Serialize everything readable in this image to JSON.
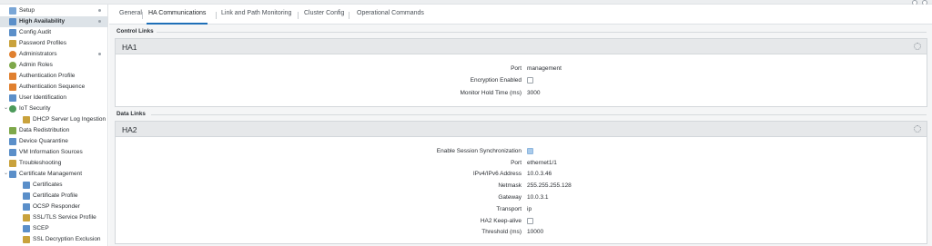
{
  "sidebar": {
    "items": [
      {
        "label": "Setup",
        "color": "#7aa6d6"
      },
      {
        "label": "High Availability",
        "color": "#5b8fc9"
      },
      {
        "label": "Config Audit",
        "color": "#5b8fc9"
      },
      {
        "label": "Password Profiles",
        "color": "#c9a23c"
      },
      {
        "label": "Administrators",
        "color": "#e0802f"
      },
      {
        "label": "Admin Roles",
        "color": "#7ea84a"
      },
      {
        "label": "Authentication Profile",
        "color": "#e0802f"
      },
      {
        "label": "Authentication Sequence",
        "color": "#e0802f"
      },
      {
        "label": "User Identification",
        "color": "#5b8fc9"
      },
      {
        "label": "IoT Security",
        "color": "#4c9a5a"
      },
      {
        "label": "DHCP Server Log Ingestion",
        "color": "#c9a23c"
      },
      {
        "label": "Data Redistribution",
        "color": "#7ea84a"
      },
      {
        "label": "Device Quarantine",
        "color": "#5b8fc9"
      },
      {
        "label": "VM Information Sources",
        "color": "#5b8fc9"
      },
      {
        "label": "Troubleshooting",
        "color": "#c9a23c"
      },
      {
        "label": "Certificate Management",
        "color": "#5b8fc9"
      },
      {
        "label": "Certificates",
        "color": "#5b8fc9"
      },
      {
        "label": "Certificate Profile",
        "color": "#5b8fc9"
      },
      {
        "label": "OCSP Responder",
        "color": "#5b8fc9"
      },
      {
        "label": "SSL/TLS Service Profile",
        "color": "#c9a23c"
      },
      {
        "label": "SCEP",
        "color": "#5b8fc9"
      },
      {
        "label": "SSL Decryption Exclusion",
        "color": "#c9a23c"
      }
    ]
  },
  "tabs": [
    "General",
    "HA Communications",
    "Link and Path Monitoring",
    "Cluster Config",
    "Operational Commands"
  ],
  "control_links": {
    "section_label": "Control Links",
    "panel_title": "HA1",
    "fields": {
      "port_label": "Port",
      "port_value": "management",
      "encryption_label": "Encryption Enabled",
      "encryption_checked": false,
      "hold_label": "Monitor Hold Time (ms)",
      "hold_value": "3000"
    }
  },
  "data_links": {
    "section_label": "Data Links",
    "panel_title": "HA2",
    "fields": {
      "sync_label": "Enable Session Synchronization",
      "sync_checked": true,
      "port_label": "Port",
      "port_value": "ethernet1/1",
      "addr_label": "IPv4/IPv6 Address",
      "addr_value": "10.0.3.46",
      "netmask_label": "Netmask",
      "netmask_value": "255.255.255.128",
      "gateway_label": "Gateway",
      "gateway_value": "10.0.3.1",
      "transport_label": "Transport",
      "transport_value": "ip",
      "keepalive_label": "HA2 Keep-alive",
      "keepalive_checked": false,
      "threshold_label": "Threshold (ms)",
      "threshold_value": "10000"
    }
  },
  "colors": {
    "accent": "#1e6fb8",
    "checked": "#a9cbeb",
    "active_row": "#dde3e8"
  }
}
